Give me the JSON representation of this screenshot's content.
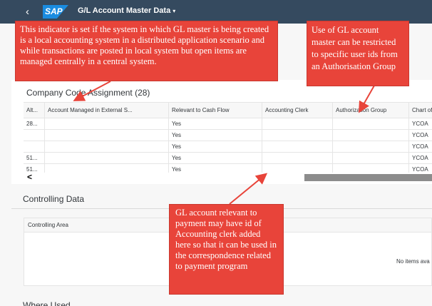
{
  "shell": {
    "back_icon": "chevron-left-icon",
    "logo": "SAP",
    "title": "G/L Account Master Data",
    "title_caret": "▾"
  },
  "company_code": {
    "title": "Company Code Assignment (28)",
    "columns": [
      "Alt...",
      "Account Managed in External S...",
      "Relevant to Cash Flow",
      "Accounting Clerk",
      "Authorization Group",
      "Chart of Accoun"
    ],
    "rows": [
      [
        "28...",
        "",
        "Yes",
        "",
        "",
        "YCOA"
      ],
      [
        "",
        "",
        "Yes",
        "",
        "",
        "YCOA"
      ],
      [
        "",
        "",
        "Yes",
        "",
        "",
        "YCOA"
      ],
      [
        "51...",
        "",
        "Yes",
        "",
        "",
        "YCOA"
      ],
      [
        "51...",
        "",
        "Yes",
        "",
        "",
        "YCOA"
      ]
    ],
    "scroll_left": "<"
  },
  "controlling": {
    "title": "Controlling Data",
    "column": "Controlling Area",
    "empty_text": "No items ava"
  },
  "where_used": {
    "title": "Where Used"
  },
  "callouts": {
    "local_system": "This indicator is set if the system in which GL master is being created is a local accounting system in a distributed application scenario and while transactions are posted in local system but open items are managed centrally in a central system.",
    "auth_group": "Use of GL account master can be restricted to specific user ids from an Authorisation Group",
    "clerk": "GL account relevant to payment may have id of Accounting clerk added here so that it can be used in the correspondence related to payment program"
  },
  "colors": {
    "shell": "#354a5f",
    "callout": "#e8443a",
    "logo": "#1a8ce0"
  }
}
